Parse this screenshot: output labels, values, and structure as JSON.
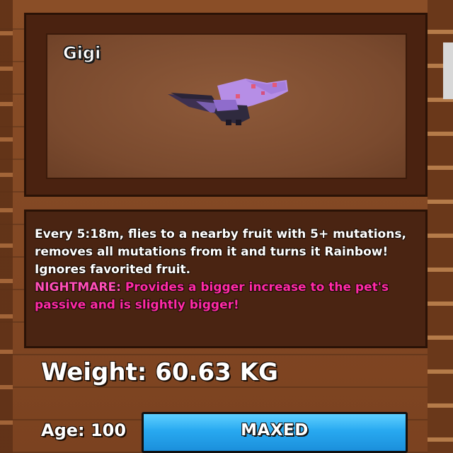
{
  "pet": {
    "name": "Gigi",
    "sprite_icon": "purple-bat-icon"
  },
  "description": {
    "lines": [
      "Every 5:18m, flies to a nearby fruit with 5+ mutations,",
      "removes all mutations from it and turns it Rainbow!",
      "Ignores favorited fruit."
    ],
    "nightmare_prefix": "NIGHTMARE:",
    "nightmare_text": " Provides a bigger increase to the pet's passive and is slightly bigger!"
  },
  "stats": {
    "weight_label": "Weight: 60.63 KG",
    "age_label": "Age: 100"
  },
  "progress": {
    "label": "MAXED",
    "fill_fraction": 1.0
  },
  "colors": {
    "nightmare": "#ff2aa6",
    "bar_fill": "#28a9f0",
    "frame": "#4a2210"
  }
}
